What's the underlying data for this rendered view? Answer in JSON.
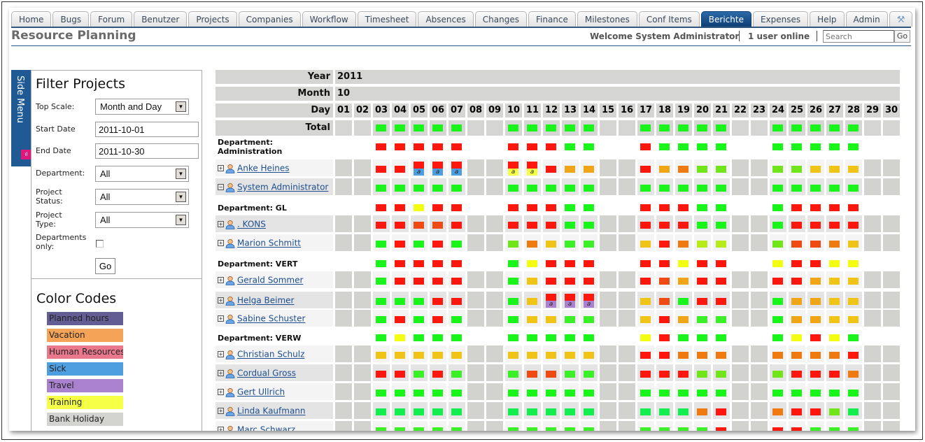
{
  "nav": {
    "tabs": [
      "Home",
      "Bugs",
      "Forum",
      "Benutzer",
      "Projects",
      "Companies",
      "Workflow",
      "Timesheet",
      "Absences",
      "Changes",
      "Finance",
      "Milestones",
      "Conf Items",
      "Berichte",
      "Expenses",
      "Help",
      "Admin"
    ],
    "active_tab": "Berichte",
    "tools_icon": "wrench-icon"
  },
  "header": {
    "title": "Resource Planning",
    "welcome": "Welcome System Administrator",
    "online": "1 user online",
    "search_placeholder": "Search",
    "search_go": "Go"
  },
  "sidebar": {
    "side_menu_label": "Side Menu",
    "filter_title": "Filter Projects",
    "fields": {
      "top_scale_label": "Top Scale:",
      "top_scale_value": "Month and Day",
      "start_date_label": "Start Date",
      "start_date_value": "2011-10-01",
      "end_date_label": "End Date",
      "end_date_value": "2011-10-30",
      "department_label": "Department:",
      "department_value": "All",
      "project_status_label": "Project Status:",
      "project_status_value": "All",
      "project_type_label": "Project Type:",
      "project_type_value": "All",
      "departments_only_label": "Departments only:",
      "departments_only_checked": false,
      "go_label": "Go"
    },
    "color_codes_title": "Color Codes",
    "color_codes": [
      {
        "label": "Planned hours",
        "color": "#625d93"
      },
      {
        "label": "Vacation",
        "color": "#f4a357"
      },
      {
        "label": "Human Resources",
        "color": "#e9788d"
      },
      {
        "label": "Sick",
        "color": "#4d9ede"
      },
      {
        "label": "Travel",
        "color": "#a981cf"
      },
      {
        "label": "Training",
        "color": "#f4ff46"
      },
      {
        "label": "Bank Holiday",
        "color": "#d3d3cf"
      }
    ]
  },
  "planning": {
    "year_label": "Year",
    "year": "2011",
    "month_label": "Month",
    "month": "10",
    "day_label": "Day",
    "days": [
      "01",
      "02",
      "03",
      "04",
      "05",
      "06",
      "07",
      "08",
      "09",
      "10",
      "11",
      "12",
      "13",
      "14",
      "15",
      "16",
      "17",
      "18",
      "19",
      "20",
      "21",
      "22",
      "23",
      "24",
      "25",
      "26",
      "27",
      "28",
      "29",
      "30"
    ],
    "weekend_days": [
      "01",
      "02",
      "08",
      "09",
      "15",
      "16",
      "22",
      "23",
      "29",
      "30"
    ],
    "status_colors": {
      "G": "#19f51a",
      "R": "#ff170d",
      "Y": "#f2fd12",
      "O": "#f0a516",
      "A": "#efc416",
      "D": "#ee7a10",
      "E": "#ef4a14",
      "L": "#70e51a",
      "K": "#b6ea18",
      "M": "#3cf028",
      "N": "#12ee4e"
    },
    "absence_colors": {
      "sick": "#4d9ede",
      "training": "#f4ff46",
      "travel": "#a981cf"
    },
    "rows": [
      {
        "type": "total",
        "label": "Total",
        "cells": "..GGGGG..GGGGG..GGGGG..GGGGG.."
      },
      {
        "type": "dept",
        "label": "Department: Administration",
        "cells": "..RRRRR..RRRGG..RGGGG..GGGGG.."
      },
      {
        "type": "person",
        "label": "Anke Heines",
        "expanded": false,
        "cells": "..RRRRR..RRROO..RODLL..LLAAA..",
        "absences": {
          "05": {
            "kind": "sick",
            "text": "a"
          },
          "06": {
            "kind": "sick",
            "text": "a"
          },
          "07": {
            "kind": "sick",
            "text": "a"
          },
          "10": {
            "kind": "training",
            "text": "a"
          },
          "11": {
            "kind": "training",
            "text": "a"
          }
        }
      },
      {
        "type": "person",
        "label": "System Administrator",
        "expanded": true,
        "cells": "..GGGGG..GGGGG..GGGGG..GGGGG.."
      },
      {
        "type": "dept",
        "label": "Department: GL",
        "cells": "..RRYRR..RRRGG..RRRGG..GRRRR.."
      },
      {
        "type": "person",
        "label": ". KONS",
        "expanded": false,
        "cells": "..RREER..RRRGG..RRRGG..GRRRR.."
      },
      {
        "type": "person",
        "label": "Marion Schmitt",
        "expanded": false,
        "cells": "..GRGRG..LDAMM..ARDKK..LEEDA.."
      },
      {
        "type": "dept",
        "label": "Department: VERT",
        "cells": "..GRRRR..GYRRR..RRYRR..YRRYY.."
      },
      {
        "type": "person",
        "label": "Gerald Sommer",
        "expanded": false,
        "cells": "..GRRRR..GARRR..REORR..RROAA.."
      },
      {
        "type": "person",
        "label": "Helga Beimer",
        "expanded": false,
        "cells": "..GGGRR..GARRR..AEGRR..GOOAA..",
        "absences": {
          "12": {
            "kind": "travel",
            "text": "a"
          },
          "13": {
            "kind": "travel",
            "text": "a"
          },
          "14": {
            "kind": "travel",
            "text": "a"
          }
        }
      },
      {
        "type": "person",
        "label": "Sabine Schuster",
        "expanded": false,
        "cells": "..GRGRG..GAAMM..AROMM..GOOAA.."
      },
      {
        "type": "dept",
        "label": "Department: VERW",
        "cells": "..GYGGG..GGGGG..YRGGG..GYRYG.."
      },
      {
        "type": "person",
        "label": "Christian Schulz",
        "expanded": false,
        "cells": "..AAAAA..AAAAA..RRDDD..DDDDR.."
      },
      {
        "type": "person",
        "label": "Cordual Gross",
        "expanded": false,
        "cells": "..RRMRM..MEEMM..RRRLL..LRRRD.."
      },
      {
        "type": "person",
        "label": "Gert Ullrich",
        "expanded": false,
        "cells": "..GGGGG..GGGGG..GGGGG..GGGGG.."
      },
      {
        "type": "person",
        "label": "Linda Kaufmann",
        "expanded": false,
        "cells": "..NNNNN..NNNNN..NNNDR..DRRLN.."
      },
      {
        "type": "person",
        "label": "Marc Schwarz",
        "expanded": false,
        "cells": "..MMMMM..MMMMM..MMMMR..RRMMM.."
      }
    ]
  }
}
